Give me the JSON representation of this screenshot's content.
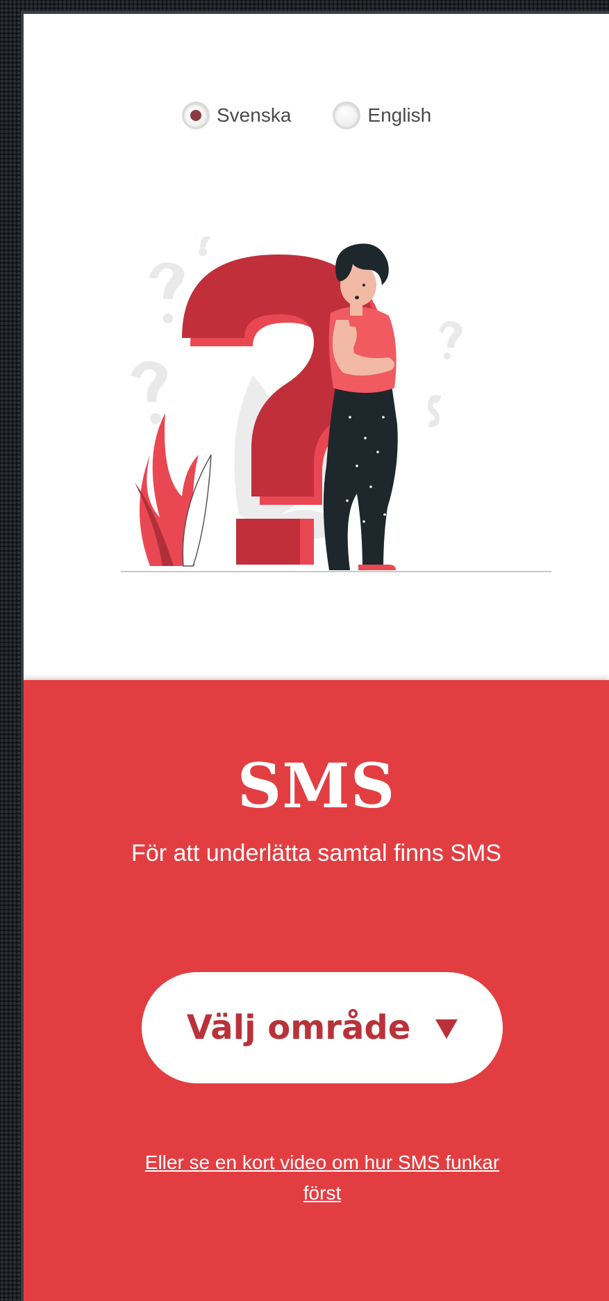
{
  "language": {
    "options": [
      {
        "label": "Svenska",
        "selected": true
      },
      {
        "label": "English",
        "selected": false
      }
    ],
    "radio_color": "#8d3b43"
  },
  "illustration": {
    "icon": "thinking-person-question-mark-illustration"
  },
  "main": {
    "title": "SMS",
    "subtitle": "För att underlätta samtal finns SMS",
    "select_label": "Välj område",
    "select_icon": "triangle-down-icon",
    "video_link": "Eller se en kort video om hur SMS funkar först"
  },
  "colors": {
    "accent": "#e23e42",
    "button_text": "#b9323a",
    "background": "#ffffff"
  }
}
